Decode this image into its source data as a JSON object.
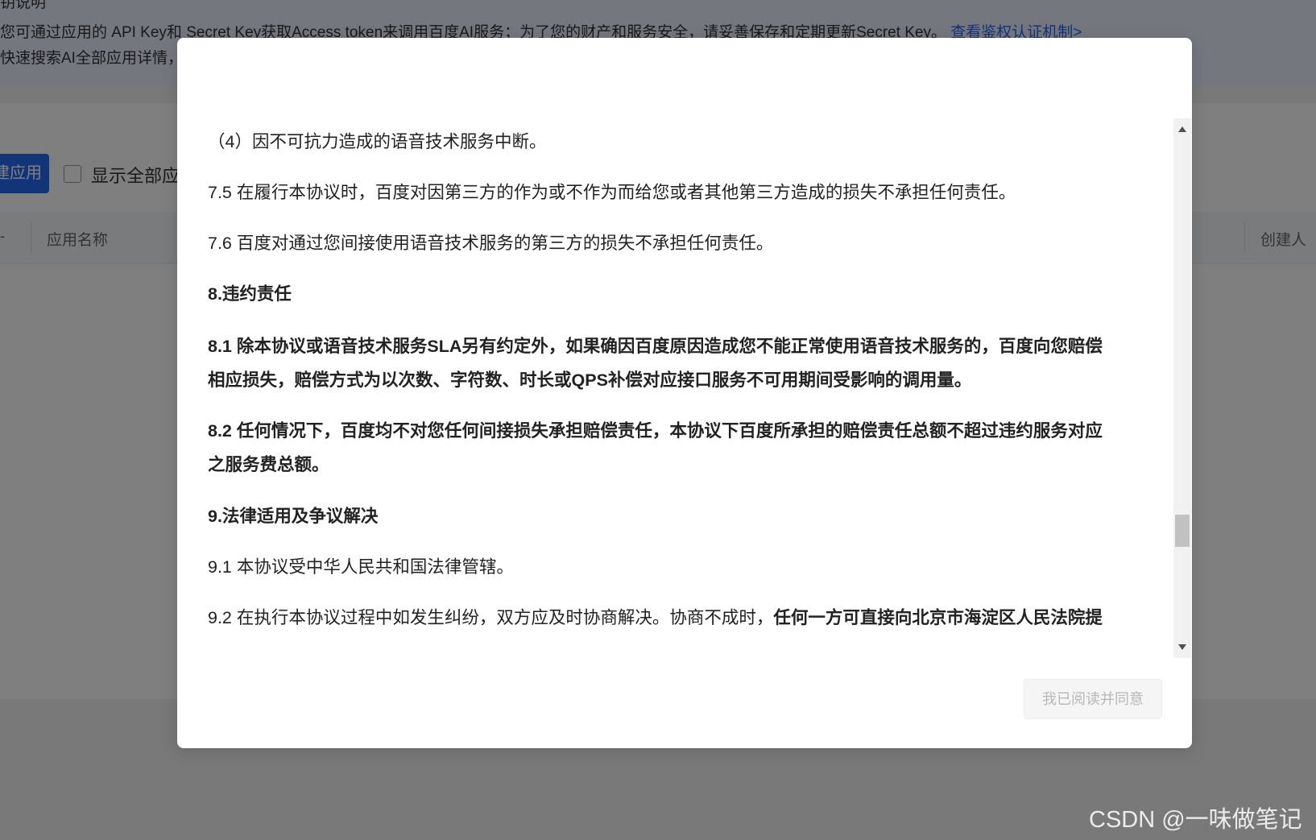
{
  "background": {
    "notice_title": "钥说明",
    "notice_line1_text": "您可通过应用的 API Key和 Secret Key获取Access  token来调用百度AI服务；为了您的财产和服务安全，请妥善保存和定期更新Secret Key。",
    "notice_line1_link": "查看鉴权认证机制>",
    "notice_line2_text": "快速搜索AI全部应用详情，",
    "create_button_label": "建应用",
    "show_all_label": "显示全部应",
    "table_col_first": "-",
    "table_col_name": "应用名称",
    "table_col_creator": "创建人"
  },
  "modal": {
    "paragraphs": [
      {
        "segments": [
          {
            "text": "（4）因不可抗力造成的语音技术服务中断。",
            "bold": false
          }
        ]
      },
      {
        "segments": [
          {
            "text": "7.5 在履行本协议时，百度对因第三方的作为或不作为而给您或者其他第三方造成的损失不承担任何责任。",
            "bold": false
          }
        ]
      },
      {
        "segments": [
          {
            "text": "7.6 百度对通过您间接使用语音技术服务的第三方的损失不承担任何责任。",
            "bold": false
          }
        ]
      },
      {
        "segments": [
          {
            "text": "8.违约责任",
            "bold": true
          }
        ]
      },
      {
        "segments": [
          {
            "text": "8.1 除本协议或语音技术服务SLA另有约定外，如果确因百度原因造成您不能正常使用语音技术服务的，百度向您赔偿",
            "bold": true
          }
        ]
      },
      {
        "segments": [
          {
            "text": "相应损失，赔偿方式为以次数、字符数、时长或QPS补偿对应接口服务不可用期间受影响的调用量。",
            "bold": true
          }
        ]
      },
      {
        "segments": [
          {
            "text": "8.2 任何情况下，百度均不对您任何间接损失承担赔偿责任，本协议下百度所承担的赔偿责任总额不超过违约服务对应",
            "bold": true
          }
        ]
      },
      {
        "segments": [
          {
            "text": "之服务费总额。",
            "bold": true
          }
        ]
      },
      {
        "segments": [
          {
            "text": "9.法律适用及争议解决",
            "bold": true
          }
        ]
      },
      {
        "segments": [
          {
            "text": "9.1 本协议受中华人民共和国法律管辖。",
            "bold": false
          }
        ]
      },
      {
        "segments": [
          {
            "text": "9.2 在执行本协议过程中如发生纠纷，双方应及时协商解决。协商不成时，",
            "bold": false
          },
          {
            "text": "任何一方可直接向北京市海淀区人民法院提",
            "bold": true
          }
        ]
      }
    ],
    "agree_button_label": "我已阅读并同意"
  },
  "watermark": "CSDN @一味做笔记"
}
